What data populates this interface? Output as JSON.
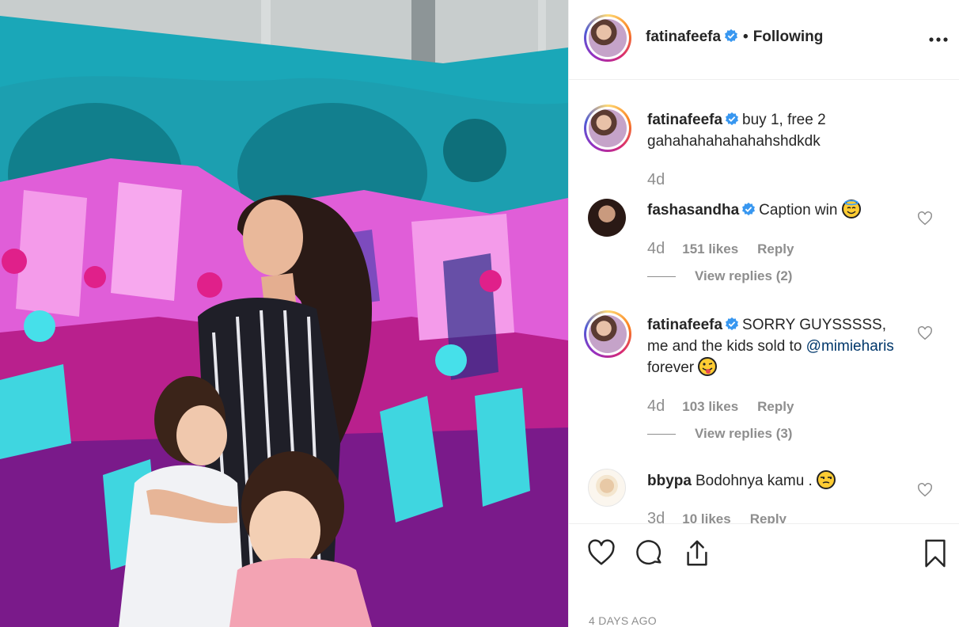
{
  "post": {
    "author": "fatinafeefa",
    "follow_status": "Following",
    "separator": "•",
    "more_icon": "more-horizontal-icon",
    "caption": "buy 1, free 2 gahahahahahahahshdkdk",
    "caption_time": "4d",
    "date": "4 DAYS AGO"
  },
  "comments": [
    {
      "username": "fashasandha",
      "verified": true,
      "text": "Caption win",
      "emoji": "smiling-face-with-halo",
      "time": "4d",
      "likes": "151 likes",
      "reply": "Reply",
      "view_replies": "View replies (2)"
    },
    {
      "username": "fatinafeefa",
      "verified": true,
      "text_before": "SORRY GUYSSSSS, me and the kids sold to",
      "mention": "@mimieharis",
      "text_after": "forever",
      "emoji": "face-with-tongue-winking",
      "time": "4d",
      "likes": "103 likes",
      "reply": "Reply",
      "view_replies": "View replies (3)"
    },
    {
      "username": "bbypa",
      "verified": false,
      "text": "Bodohnya kamu .",
      "emoji": "unamused-face",
      "time": "3d",
      "likes": "10 likes",
      "reply": "Reply"
    }
  ],
  "actions": {
    "like_icon": "heart-icon",
    "comment_icon": "comment-icon",
    "share_icon": "share-icon",
    "save_icon": "bookmark-icon"
  },
  "colors": {
    "text": "#262626",
    "secondary": "#8e8e8e",
    "verified": "#3897f0",
    "mention": "#00376b",
    "border": "#efefef"
  }
}
